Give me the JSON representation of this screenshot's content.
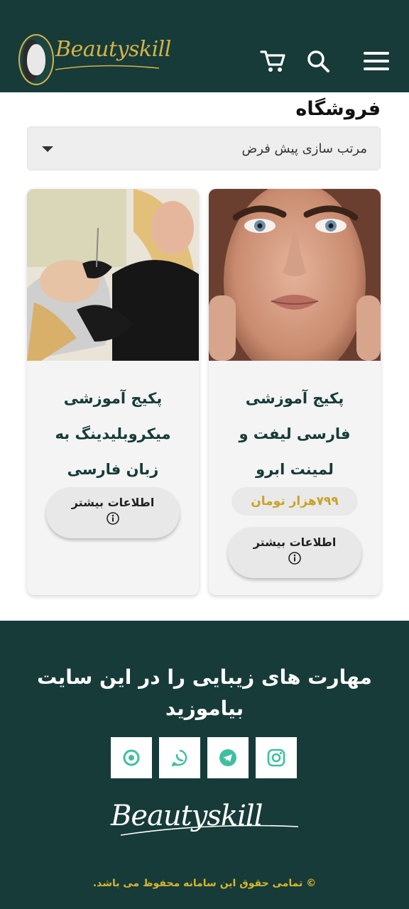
{
  "header": {
    "logo_text": "Beautyskill",
    "icons": [
      "cart-icon",
      "search-icon",
      "menu-icon"
    ]
  },
  "shop": {
    "title": "فروشگاه",
    "sort_selected": "مرتب سازی پیش فرض"
  },
  "products": [
    {
      "title_lines": [
        "پکیج آموزشی",
        "فارسی لیفت و",
        "لمینت ابرو"
      ],
      "price": "۷۹۹هزار تومان",
      "more_label": "اطلاعات بیشتر"
    },
    {
      "title_lines": [
        "پکیج آموزشی",
        "میکروبلیدینگ به",
        "زبان فارسی"
      ],
      "more_label": "اطلاعات بیشتر"
    }
  ],
  "footer": {
    "heading_line1": "مهارت های زیبایی را در این سایت",
    "heading_line2": "بیاموزید",
    "social": [
      "instagram-icon",
      "telegram-icon",
      "whatsapp-icon",
      "aparat-icon"
    ],
    "logo_text": "Beautyskill",
    "copyright": "© تمامی حقوق این سامانه محفوظ می باشد."
  },
  "colors": {
    "brand_dark": "#163b39",
    "gold": "#d7b24a",
    "price": "#c9a227",
    "social_accent": "#3fbfa0"
  }
}
